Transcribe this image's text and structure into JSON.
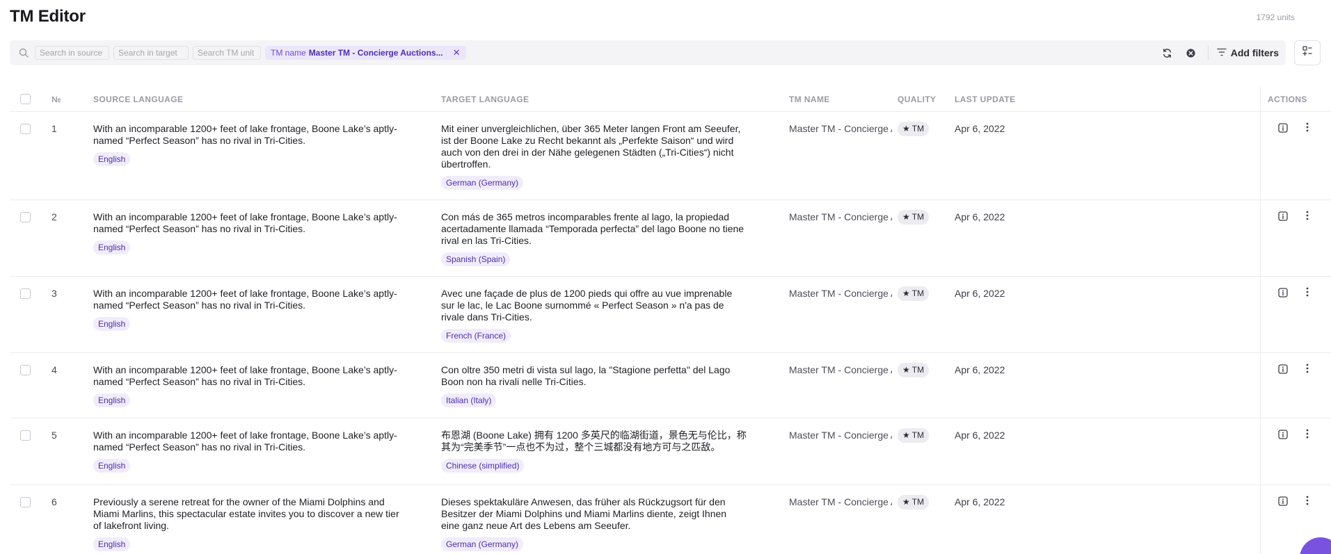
{
  "app": {
    "title": "TM Editor",
    "units": "1792 units"
  },
  "filters": {
    "search_source_placeholder": "Search in source",
    "search_target_placeholder": "Search in target",
    "search_unit_placeholder": "Search TM unit",
    "tm_chip_key": "TM name",
    "tm_chip_value": "Master TM - Concierge Auctions...",
    "add_filters_label": "Add filters"
  },
  "table": {
    "columns": {
      "number": "№",
      "source": "SOURCE LANGUAGE",
      "target": "TARGET LANGUAGE",
      "tm_name": "TM NAME",
      "quality": "QUALITY",
      "last_update": "LAST UPDATE",
      "actions": "ACTIONS"
    },
    "rows": [
      {
        "num": "1",
        "source": "With an incomparable 1200+ feet of lake frontage, Boone Lake’s aptly-named “Perfect Season” has no rival in Tri-Cities.",
        "source_lang": "English",
        "target": "Mit einer unvergleichlichen, über 365 Meter langen Front am Seeufer, ist der Boone Lake zu Recht bekannt als „Perfekte Saison“ und wird auch von den drei in der Nähe gelegenen Städten („Tri-Cities“) nicht übertroffen.",
        "target_lang": "German (Germany)",
        "tm_name": "Master TM - Concierge Auctions",
        "quality": "TM",
        "last_update": "Apr 6, 2022"
      },
      {
        "num": "2",
        "source": "With an incomparable 1200+ feet of lake frontage, Boone Lake’s aptly-named “Perfect Season” has no rival in Tri-Cities.",
        "source_lang": "English",
        "target": "Con más de 365 metros incomparables frente al lago, la propiedad acertadamente llamada “Temporada perfecta” del lago Boone no tiene rival en las Tri-Cities.",
        "target_lang": "Spanish (Spain)",
        "tm_name": "Master TM - Concierge Auctions",
        "quality": "TM",
        "last_update": "Apr 6, 2022"
      },
      {
        "num": "3",
        "source": "With an incomparable 1200+ feet of lake frontage, Boone Lake’s aptly-named “Perfect Season” has no rival in Tri-Cities.",
        "source_lang": "English",
        "target": "Avec une façade de plus de 1200 pieds qui offre au vue imprenable sur le lac, le Lac Boone surnommé « Perfect Season » n'a pas de rivale dans Tri-Cities.",
        "target_lang": "French (France)",
        "tm_name": "Master TM - Concierge Auctions",
        "quality": "TM",
        "last_update": "Apr 6, 2022"
      },
      {
        "num": "4",
        "source": "With an incomparable 1200+ feet of lake frontage, Boone Lake’s aptly-named “Perfect Season” has no rival in Tri-Cities.",
        "source_lang": "English",
        "target": "Con oltre 350 metri di vista sul lago, la \"Stagione perfetta\" del Lago Boon non ha rivali nelle Tri-Cities.",
        "target_lang": "Italian (Italy)",
        "tm_name": "Master TM - Concierge Auctions",
        "quality": "TM",
        "last_update": "Apr 6, 2022"
      },
      {
        "num": "5",
        "source": "With an incomparable 1200+ feet of lake frontage, Boone Lake’s aptly-named “Perfect Season” has no rival in Tri-Cities.",
        "source_lang": "English",
        "target": "布恩湖 (Boone Lake) 拥有 1200 多英尺的临湖街道，景色无与伦比，称其为“完美季节”一点也不为过，整个三城都没有地方可与之匹敌。",
        "target_lang": "Chinese (simplified)",
        "tm_name": "Master TM - Concierge Auctions",
        "quality": "TM",
        "last_update": "Apr 6, 2022"
      },
      {
        "num": "6",
        "source": "Previously a serene retreat for the owner of the Miami Dolphins and Miami Marlins, this spectacular estate invites you to discover a new tier of lakefront living.",
        "source_lang": "English",
        "target": "Dieses spektakuläre Anwesen, das früher als Rückzugsort für den Besitzer der Miami Dolphins und Miami Marlins diente, zeigt Ihnen eine ganz neue Art des Lebens am Seeufer.",
        "target_lang": "German (Germany)",
        "tm_name": "Master TM - Concierge Auctions",
        "quality": "TM",
        "last_update": "Apr 6, 2022"
      }
    ]
  }
}
